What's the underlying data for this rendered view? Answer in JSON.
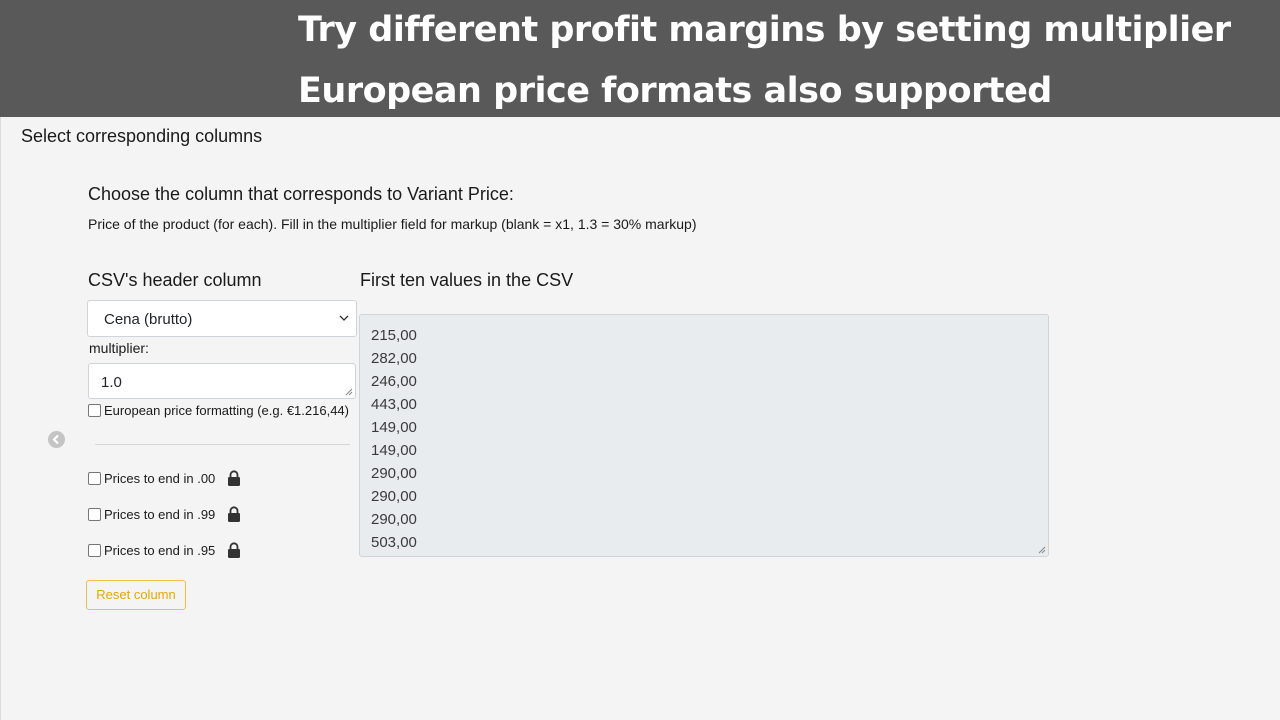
{
  "banner": {
    "line1": "Try different profit margins by setting multiplier",
    "line2": "European price formats also supported"
  },
  "section_title": "Select corresponding columns",
  "prompt": {
    "title": "Choose the column that corresponds to Variant Price:",
    "description": "Price of the product (for each). Fill in the multiplier field for markup (blank = x1, 1.3 = 30% markup)"
  },
  "columns": {
    "left_header": "CSV's header column",
    "right_header": "First ten values in the CSV"
  },
  "select": {
    "value": "Cena (brutto)"
  },
  "multiplier": {
    "label": "multiplier:",
    "value": "1.0"
  },
  "european": {
    "label": "European price formatting (e.g. €1.216,44)",
    "checked": false
  },
  "rounding": [
    {
      "label": "Prices to end in .00",
      "checked": false
    },
    {
      "label": "Prices to end in .99",
      "checked": false
    },
    {
      "label": "Prices to end in .95",
      "checked": false
    }
  ],
  "reset_label": "Reset column",
  "values": [
    "215,00",
    "282,00",
    "246,00",
    "443,00",
    "149,00",
    "149,00",
    "290,00",
    "290,00",
    "290,00",
    "503,00"
  ],
  "colors": {
    "banner_bg": "#595959",
    "page_bg": "#f4f4f4",
    "accent": "#f0c14b"
  }
}
